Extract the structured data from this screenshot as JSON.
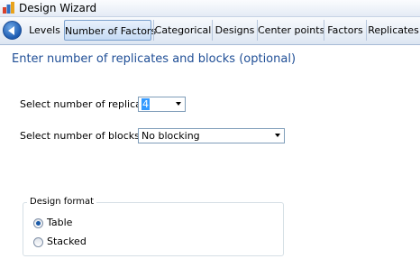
{
  "window": {
    "title": "Design Wizard"
  },
  "tabs": [
    "Levels",
    "Number of Factors",
    "Categorical",
    "Designs",
    "Center points",
    "Factors",
    "Replicates"
  ],
  "active_tab": "Number of Factors",
  "heading": "Enter number of replicates and blocks (optional)",
  "replicates": {
    "label": "Select number of replicates:",
    "value": "4"
  },
  "blocks": {
    "label": "Select number of blocks:",
    "value": "No blocking"
  },
  "design_format": {
    "title": "Design format",
    "options": [
      "Table",
      "Stacked"
    ],
    "selected": "Table"
  }
}
